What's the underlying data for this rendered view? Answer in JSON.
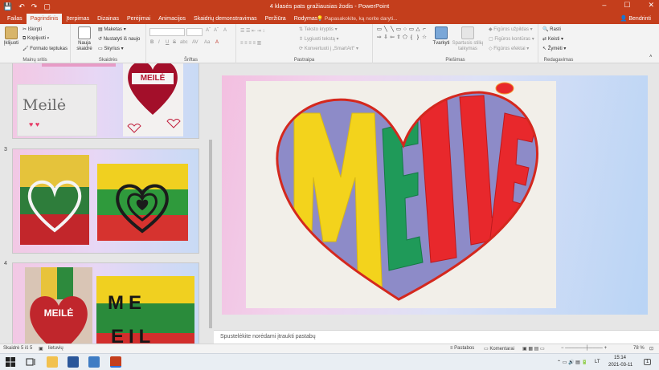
{
  "window": {
    "title": "4 klasės pats gražiausias žodis - PowerPoint",
    "share": "Bendrinti",
    "tell_me": "Papasakokite, ką norite daryti...",
    "min": "–",
    "max": "☐",
    "close": "✕"
  },
  "qat": {
    "save": "💾",
    "undo": "↶",
    "redo": "↷",
    "start": "▢"
  },
  "tabs": [
    "Failas",
    "Pagrindinis",
    "Įterpimas",
    "Dizainas",
    "Perėjimai",
    "Animacijos",
    "Skaidrių demonstravimas",
    "Peržiūra",
    "Rodymas"
  ],
  "ribbon": {
    "clipboard": {
      "paste": "Įklijuoti",
      "cut": "Iškirpti",
      "copy": "Kopijuoti",
      "format": "Formato teptukas",
      "label": "Mainų sritis"
    },
    "slides": {
      "new": "Nauja skaidrė",
      "layout": "Maketas",
      "reset": "Nustatyti iš naujo",
      "section": "Skyrius",
      "label": "Skaidrės"
    },
    "font": {
      "bold": "B",
      "italic": "I",
      "underline": "U",
      "strike": "S",
      "shadow": "abc",
      "spacing": "AV",
      "case": "Aa",
      "grow": "A",
      "shrink": "A",
      "clear": "A",
      "color": "A",
      "label": "Šriftas"
    },
    "paragraph": {
      "direction": "Teksto kryptis",
      "align": "Lygiuoti tekstą",
      "smartart": "Konvertuoti į „SmartArt“",
      "label": "Pastraipa"
    },
    "drawing": {
      "arrange": "Tvarkyti",
      "quick_styles": "Spartusis stilių taikymas",
      "fill": "Figūros užpildas",
      "outline": "Figūros kontūras",
      "effects": "Figūros efektai",
      "label": "Piešimas"
    },
    "editing": {
      "find": "Rasti",
      "replace": "Keisti",
      "select": "Žymėti",
      "label": "Redagavimas"
    }
  },
  "shapes": [
    "▭",
    "╲",
    "╲",
    "▭",
    "○",
    "▭",
    "△",
    "⌐",
    "⇨",
    "⇩",
    "⇦",
    "⇧",
    "⬠",
    "{",
    "}",
    "☆"
  ],
  "slides_panel": {
    "numbers": [
      "3",
      "4"
    ],
    "thumb2_word": "Meilė",
    "thumb2_heart_word": "MEILĖ",
    "thumb4_heart_word": "MEILĖ",
    "thumb4_flag_word_1": "ME",
    "thumb4_flag_word_2": "EIL"
  },
  "main_slide": {
    "letters": [
      "M",
      "E",
      "I",
      "L",
      "Ė"
    ]
  },
  "notes": "Spustelėkite norėdami įtraukti pastabų",
  "status": {
    "slide": "Skaidrė 5 iš 5",
    "language": "lietuvių",
    "notes_btn": "Pastabos",
    "comments_btn": "Komentarai",
    "zoom": "78 %"
  },
  "taskbar": {
    "language": "LT",
    "time": "15:14",
    "date": "2021-03-11",
    "notification": "1"
  },
  "colors": {
    "accent": "#c43e1c",
    "yellow": "#f3d31c",
    "violet": "#8b89c9",
    "green": "#1e9b58",
    "red": "#e8282c"
  }
}
